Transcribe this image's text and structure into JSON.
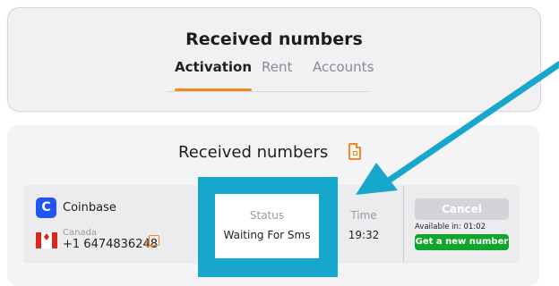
{
  "header": {
    "title": "Received numbers",
    "tabs": [
      {
        "label": "Activation",
        "active": true
      },
      {
        "label": "Rent",
        "active": false
      },
      {
        "label": "Accounts",
        "active": false
      }
    ]
  },
  "main": {
    "title": "Received numbers",
    "icon": "document-icon"
  },
  "order": {
    "service": {
      "name": "Coinbase",
      "logo_letter": "C",
      "logo_color": "#1f55f4"
    },
    "country": "Canada",
    "phone": "+1 6474836248",
    "status_label": "Status",
    "status_value": "Waiting For Sms",
    "time_label": "Time",
    "time_value": "19:32",
    "cancel_label": "Cancel",
    "available_in": "Available in: 01:02",
    "new_number_label": "Get a new number"
  },
  "colors": {
    "accent": "#f08a24",
    "annotation": "#17a7cc",
    "success": "#12a52c",
    "disabled": "#d4d4d8"
  }
}
